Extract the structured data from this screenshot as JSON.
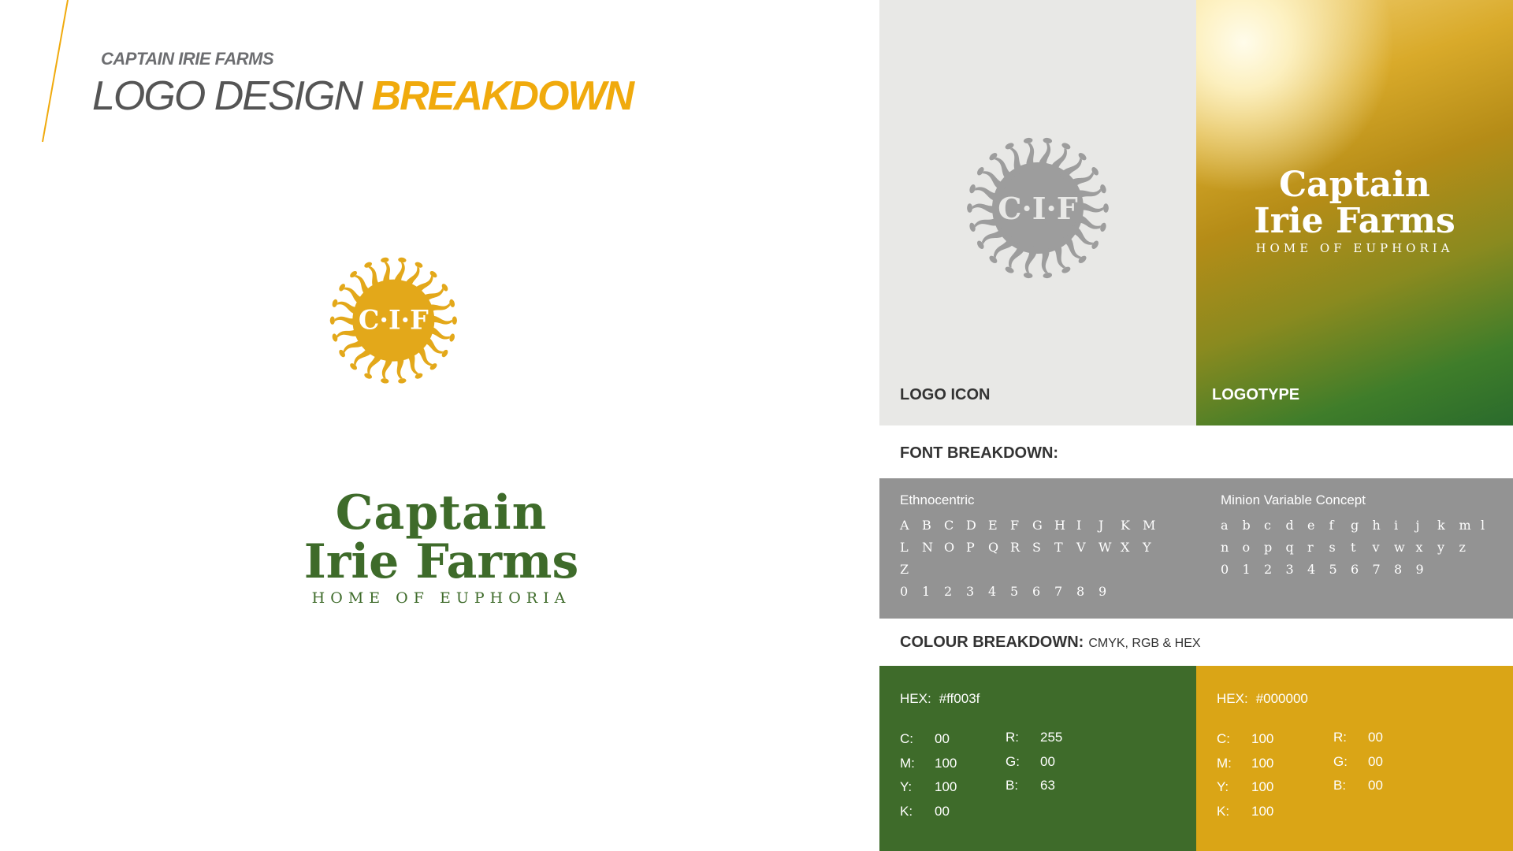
{
  "header": {
    "kicker": "CAPTAIN IRIE FARMS",
    "title_thin": "LOGO DESIGN",
    "title_bold": "BREAKDOWN"
  },
  "main_logo": {
    "monogram": "C·I·F",
    "line1": "Captain",
    "line2": "Irie Farms",
    "tagline": "HOME OF EUPHORIA",
    "color_gold": "#e3a81a",
    "color_green": "#3e6b2a"
  },
  "logo_icon_panel": {
    "label": "LOGO ICON",
    "monogram": "C·I·F",
    "color": "#9d9d9d"
  },
  "logotype_panel": {
    "label": "LOGOTYPE",
    "line1": "Captain",
    "line2": "Irie Farms",
    "tagline": "HOME OF EUPHORIA"
  },
  "font_breakdown": {
    "title": "FONT BREAKDOWN:",
    "fonts": [
      {
        "name": "Ethnocentric",
        "rows": [
          [
            "A",
            "B",
            "C",
            "D",
            "E",
            "F",
            "G",
            "H",
            "I",
            "J",
            "K",
            "M"
          ],
          [
            "L",
            "N",
            "O",
            "P",
            "Q",
            "R",
            "S",
            "T",
            "V",
            "W",
            "X",
            "Y"
          ],
          [
            "Z"
          ],
          [
            "0",
            "1",
            "2",
            "3",
            "4",
            "5",
            "6",
            "7",
            "8",
            "9"
          ]
        ]
      },
      {
        "name": "Minion Variable Concept",
        "rows": [
          [
            "a",
            "b",
            "c",
            "d",
            "e",
            "f",
            "g",
            "h",
            "i",
            "j",
            "k",
            "m",
            "l"
          ],
          [
            "n",
            "o",
            "p",
            "q",
            "r",
            "s",
            "t",
            "v",
            "w",
            "x",
            "y",
            "z"
          ],
          [
            "0",
            "1",
            "2",
            "3",
            "4",
            "5",
            "6",
            "7",
            "8",
            "9"
          ]
        ]
      }
    ]
  },
  "colour_breakdown": {
    "title": "COLOUR BREAKDOWN:",
    "subtitle": "CMYK, RGB & HEX",
    "swatches": [
      {
        "swatch_color": "#3e6b2a",
        "hex_label": "HEX:",
        "hex_value": "#ff003f",
        "cmyk": [
          [
            "C:",
            "00"
          ],
          [
            "M:",
            "100"
          ],
          [
            "Y:",
            "100"
          ],
          [
            "K:",
            "00"
          ]
        ],
        "rgb": [
          [
            "R:",
            "255"
          ],
          [
            "G:",
            "00"
          ],
          [
            "B:",
            "63"
          ]
        ]
      },
      {
        "swatch_color": "#daa516",
        "hex_label": "HEX:",
        "hex_value": "#000000",
        "cmyk": [
          [
            "C:",
            "100"
          ],
          [
            "M:",
            "100"
          ],
          [
            "Y:",
            "100"
          ],
          [
            "K:",
            "100"
          ]
        ],
        "rgb": [
          [
            "R:",
            "00"
          ],
          [
            "G:",
            "00"
          ],
          [
            "B:",
            "00"
          ]
        ]
      }
    ]
  }
}
